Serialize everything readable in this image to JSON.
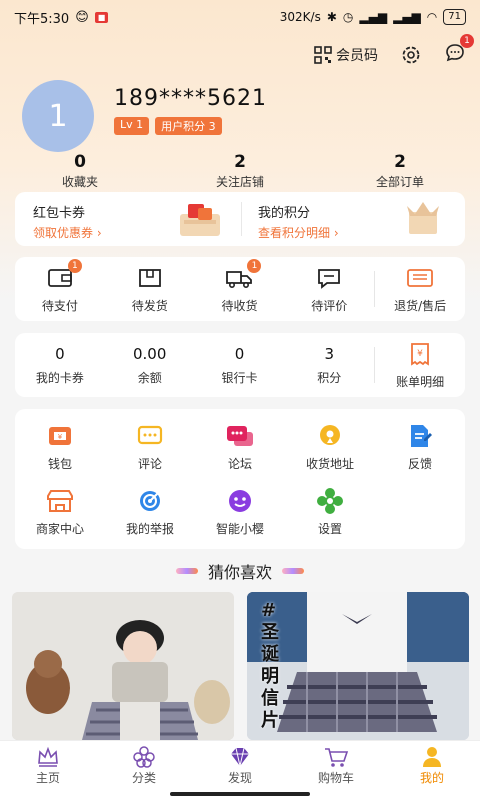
{
  "status": {
    "time": "下午5:30",
    "speed": "302K/s",
    "battery": "71"
  },
  "top": {
    "member_code": "会员码",
    "message_count": "1"
  },
  "user": {
    "avatar_text": "1",
    "phone": "189****5621",
    "level": "Lv 1",
    "points_tag": "用户积分 3"
  },
  "stats": [
    {
      "value": "0",
      "label": "收藏夹"
    },
    {
      "value": "2",
      "label": "关注店铺"
    },
    {
      "value": "2",
      "label": "全部订单"
    }
  ],
  "promo": {
    "left_title": "红包卡券",
    "left_sub": "领取优惠券 ›",
    "right_title": "我的积分",
    "right_sub": "查看积分明细 ›"
  },
  "orders": [
    {
      "label": "待支付",
      "badge": "1",
      "icon": "wallet-card-icon"
    },
    {
      "label": "待发货",
      "badge": "",
      "icon": "box-icon"
    },
    {
      "label": "待收货",
      "badge": "1",
      "icon": "truck-icon"
    },
    {
      "label": "待评价",
      "badge": "",
      "icon": "comment-icon"
    },
    {
      "label": "退货/售后",
      "badge": "",
      "icon": "return-icon"
    }
  ],
  "wallet": [
    {
      "value": "0",
      "label": "我的卡券"
    },
    {
      "value": "0.00",
      "label": "余额"
    },
    {
      "value": "0",
      "label": "银行卡"
    },
    {
      "value": "3",
      "label": "积分"
    },
    {
      "value": "",
      "label": "账单明细"
    }
  ],
  "services": [
    {
      "label": "钱包",
      "icon": "wallet-icon",
      "color": "#f0743a"
    },
    {
      "label": "评论",
      "icon": "comment-icon",
      "color": "#f5b623"
    },
    {
      "label": "论坛",
      "icon": "forum-icon",
      "color": "#e0245e"
    },
    {
      "label": "收货地址",
      "icon": "location-icon",
      "color": "#f5b623"
    },
    {
      "label": "反馈",
      "icon": "feedback-icon",
      "color": "#2f86e8"
    },
    {
      "label": "商家中心",
      "icon": "store-icon",
      "color": "#f0743a"
    },
    {
      "label": "我的举报",
      "icon": "report-icon",
      "color": "#2f86e8"
    },
    {
      "label": "智能小樱",
      "icon": "robot-icon",
      "color": "#8a3ce0"
    },
    {
      "label": "设置",
      "icon": "gear-flower-icon",
      "color": "#3fae3f"
    }
  ],
  "guess_title": "猜你喜欢",
  "product2_text": "#圣诞明信片",
  "tabs": [
    {
      "label": "主页",
      "icon": "crown-icon"
    },
    {
      "label": "分类",
      "icon": "flower-icon"
    },
    {
      "label": "发现",
      "icon": "diamond-icon"
    },
    {
      "label": "购物车",
      "icon": "cart-icon"
    },
    {
      "label": "我的",
      "icon": "person-icon",
      "active": true
    }
  ],
  "colors": {
    "accent": "#f0743a",
    "active_tab": "#f08a00"
  }
}
